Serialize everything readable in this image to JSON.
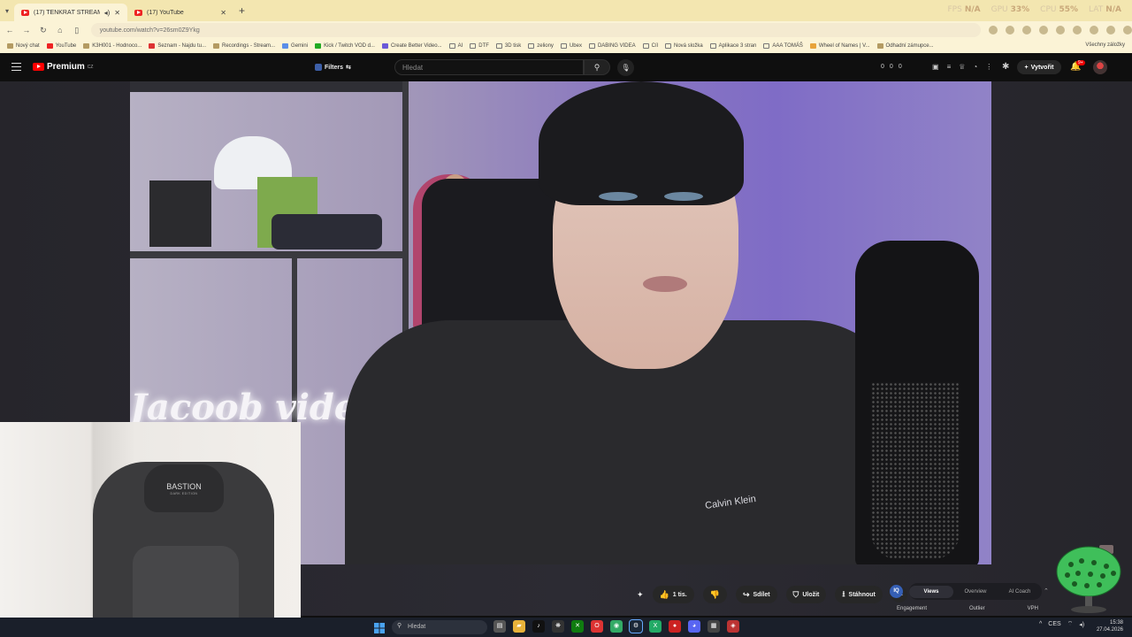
{
  "browser": {
    "tabs": [
      {
        "title": "(17) TENKRÁT STREAM EKO...",
        "active": true
      },
      {
        "title": "(17) YouTube",
        "active": false
      }
    ],
    "new_tab": "+",
    "url": "youtube.com/watch?v=26sm0Z9Ykg",
    "perf": {
      "fps_label": "FPS",
      "fps_value": "N/A",
      "gpu_label": "GPU",
      "gpu_value": "33%",
      "cpu_label": "CPU",
      "cpu_value": "55%",
      "lat_label": "LAT",
      "lat_value": "N/A"
    },
    "bookmarks": [
      "Nový chat",
      "YouTube",
      "K3H001 - Hodnoco...",
      "Seznam - Najdu tu...",
      "Recordings - Stream...",
      "Gemini",
      "Kick / Twitch VOD d...",
      "Create Better Video...",
      "AI",
      "DTF",
      "3D tisk",
      "zeliony",
      "Ubex",
      "DABING VIDEA",
      "Cíl",
      "Nová složka",
      "Aplikace 3 stran",
      "AAA TOMÁŠ",
      "Wheel of Names | V...",
      "Odhadní zámupce..."
    ],
    "all_bookmarks": "Všechny záložky"
  },
  "youtube": {
    "logo": "Premium",
    "logo_sup": "CZ",
    "filters": "Filters",
    "search_placeholder": "Hledat",
    "stats": [
      "0",
      "0",
      "0"
    ],
    "create": "Vytvořit",
    "notif_count": "9+"
  },
  "video": {
    "neon_sign": "Jacoob video",
    "shirt_logo": "Calvin Klein"
  },
  "controls": {
    "likes": "1 tis.",
    "share": "Sdílet",
    "save": "Uložit",
    "download": "Stáhnout"
  },
  "iq_panel": {
    "logo": "IQ",
    "tabs": [
      "Views",
      "Overview",
      "AI Coach"
    ],
    "metrics": [
      "Engagement",
      "Outlier",
      "VPH"
    ]
  },
  "webcam": {
    "brand": "BASTION",
    "brand_sub": "DARK EDITION"
  },
  "taskbar": {
    "search": "Hledat",
    "lang": "CES",
    "time": "15:38",
    "date": "27.04.2026"
  }
}
